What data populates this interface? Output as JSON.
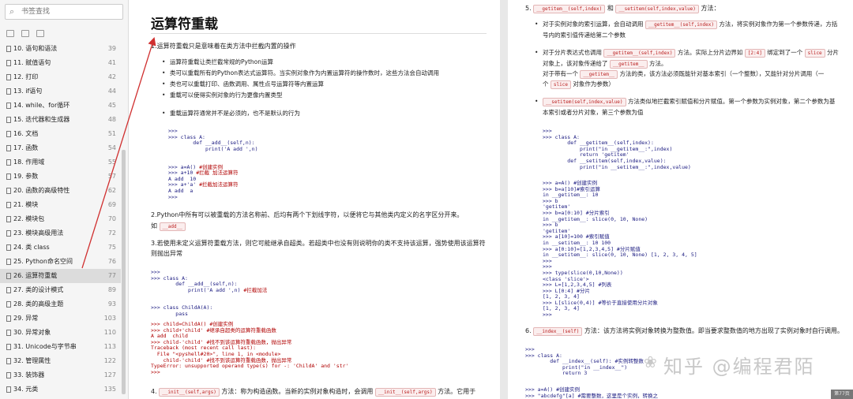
{
  "sidebar": {
    "search_placeholder": "书签查找",
    "items": [
      {
        "label": "10. 语句和语法",
        "page": "39"
      },
      {
        "label": "11. 赋值语句",
        "page": "41"
      },
      {
        "label": "12. 打印",
        "page": "42"
      },
      {
        "label": "13. if语句",
        "page": "44"
      },
      {
        "label": "14. while、for循环",
        "page": "45"
      },
      {
        "label": "15. 迭代器和生成器",
        "page": "48"
      },
      {
        "label": "16. 文档",
        "page": "51"
      },
      {
        "label": "17. 函数",
        "page": "54"
      },
      {
        "label": "18. 作用域",
        "page": "55"
      },
      {
        "label": "19. 参数",
        "page": "57"
      },
      {
        "label": "20. 函数的高级特性",
        "page": "62"
      },
      {
        "label": "21. 模块",
        "page": "69"
      },
      {
        "label": "22. 模块包",
        "page": "70"
      },
      {
        "label": "23. 模块高级用法",
        "page": "72"
      },
      {
        "label": "24. 类 class",
        "page": "75"
      },
      {
        "label": "25. Python命名空间",
        "page": "76"
      },
      {
        "label": "26. 运算符重载",
        "page": "77"
      },
      {
        "label": "27. 类的设计模式",
        "page": "89"
      },
      {
        "label": "28. 类的高级主题",
        "page": "93"
      },
      {
        "label": "29. 异常",
        "page": "103"
      },
      {
        "label": "30. 异常对象",
        "page": "110"
      },
      {
        "label": "31. Unicode与字节串",
        "page": "113"
      },
      {
        "label": "32. 管理属性",
        "page": "122"
      },
      {
        "label": "33. 装饰器",
        "page": "127"
      },
      {
        "label": "34. 元类",
        "page": "135"
      },
      {
        "label": "35. Python 执行细节",
        "page": "146"
      }
    ]
  },
  "page1": {
    "title": "运算符重载",
    "s1": "1.运算符重载只是意味着在类方法中拦截内置的操作",
    "bullets": [
      "运算符重载让类拦截常规的Python运算",
      "类可以重载所有的Python表达式运算符。当实例对象作为内置运算符的操作数时，这些方法会自动调用",
      "类也可以重载打印、函数调用、属性点号运算符等内置运算",
      "重载可以使得实例对象的行为更像内置类型",
      "重载运算符通常并不是必须的，也不是默认的行为"
    ],
    "code1": ">>>\n>>> class A:\n        def __add__(self,n):\n            print('A add ',n)",
    "code2a": ">>> a=A() ",
    "code2a_c": "#创建实例",
    "code2b": ">>> a+10 ",
    "code2b_c": "#拦截 加法运算符",
    "code2c": "A add  10",
    "code2d": ">>> a+'a' ",
    "code2d_c": "#拦截加法运算符",
    "code2e": "A add  a\n>>>",
    "s2": "2.Python中所有可以被重载的方法名称前、后均有两个下划线字符，以便将它与其他类内定义的名字区分开来。",
    "s2b": "如",
    "s2_code": "__add__",
    "s3": "3.若使用未定义运算符重载方法，则它可能继承自超类。若超类中也没有则说明你的类不支持该运算，强势使用该运算符则抛出异常",
    "code3": ">>>\n>>> class A:\n        def __add__(self,n):\n            print('A add ',n) ",
    "code3_c": "#拦截加法",
    "code4": ">>> class ChildA(A):\n        pass",
    "code5": ">>> child=ChildA() #创建实例\n>>> child+'child' #继承自超类的运算符重载函数\nA add  child\n>>> child-'child' #找不到该运算符重载函数，抛出异常\nTraceback (most recent call last):\n  File \"<pyshell#20>\", line 1, in <module>\n    child-'child' #找不到该运算符重载函数，抛出异常\nTypeError: unsupported operand type(s) for -: 'ChildA' and 'str'\n>>>",
    "s4a": "4.",
    "s4_code1": "__init__(self,args)",
    "s4b": "方法：称为构造函数。当新的实例对象构造时，会调用",
    "s4_code2": "__init__(self,args)",
    "s4c": "方法。它用于"
  },
  "page2": {
    "s5a": "5.",
    "s5_code1": "__getitem__(self,index)",
    "s5b": "和",
    "s5_code2": "__setitem(self,index,value)",
    "s5c": "方法：",
    "b1a": "对于实例对象的索引运算，会自动调用",
    "b1_code": "__getitem__(self,index)",
    "b1b": "方法，将实例对象作为第一个参数传递，方括",
    "b1c": "号内的索引值传递给第二个参数",
    "b2a": "对于分片表达式也调用",
    "b2_code1": "__getitem__(self,index)",
    "b2b": "方法。实际上分片边界如",
    "b2_code2": "[2:4]",
    "b2c": "绑定到了一个",
    "b2_code3": "slice",
    "b2d": "分片",
    "b2e": "对象上，该对象传递给了",
    "b2_code4": "__getitem__",
    "b2f": "方法。",
    "b2g": "对于带有一个",
    "b2_code5": "__getitem__",
    "b2h": "方法的类，该方法必须既能针对基本索引（一个整数），又能针对分片调用（一",
    "b2i": "个",
    "b2_code6": "slice",
    "b2j": "对象作为参数）",
    "b3_code": "__setitem(self,index,value)",
    "b3a": "方法类似地拦截索引赋值和分片赋值。第一个参数为实例对象，第二个参数为基",
    "b3b": "本索引或者分片对象，第三个参数为值",
    "code1": ">>>\n>>> class A:\n        def __getitem__(self,index):\n            print(\"in __getitem__:\",index)\n            return 'getitem'\n        def __setitem(self,index,value):\n            print(\"in __setitem__:\",index,value)",
    "code2": ">>> a=A() #创建实例\n>>> b=a[10]#索引运算\nin __getitem__: 10\n>>> b\n'getitem'\n>>> b=a[0:10] #分片索引\nin __getitem__: slice(0, 10, None)\n>>> b\n'getitem'\n>>> a[10]=100 #索引赋值\nin __setitem__: 10 100\n>>> a[0:10]=[1,2,3,4,5] #分片赋值\nin __setitem__: slice(0, 10, None) [1, 2, 3, 4, 5]\n>>>\n>>>\n>>> type(slice(0,10,None))\n<class 'slice'>\n>>> L=[1,2,3,4,5] #列表\n>>> L[0:4] #分片\n[1, 2, 3, 4]\n>>> L[slice(0,4)] #等价于直接使用分片对象\n[1, 2, 3, 4]\n>>>",
    "s6a": "6.",
    "s6_code": "__index__(self)",
    "s6b": "方法：该方法将实例对象转换为整数值。即当要求整数值的地方出现了实例对象时自行调用。",
    "code3": ">>>\n>>> class A:\n        def __index__(self): #实例转整数\n            print(\"in __index__\")\n            return 3",
    "code4": ">>> a=A() #创建实例\n>>> \"abcdefg\"[a] #需要整数，这里是个实例，转换之"
  },
  "watermark": "知乎 @编程君陌",
  "page_indicator": "第77页",
  "colors": {
    "accent_red": "#d03030",
    "code_blue": "#1a1a80",
    "comment_red": "#b00000"
  }
}
